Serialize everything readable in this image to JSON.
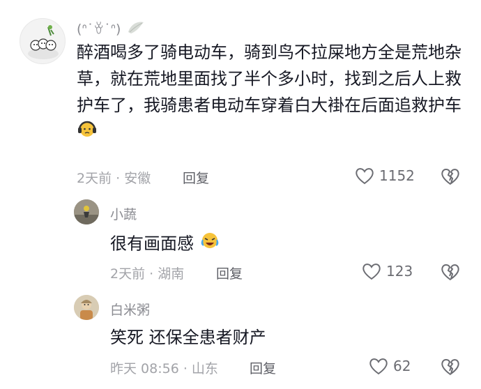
{
  "comments": [
    {
      "username": "(ᐢ˙ꈊ˙ᐢ)",
      "text": "醉酒喝多了骑电动车，骑到鸟不拉屎地方全是荒地杂草，就在荒地里面找了半个多小时，找到之后人上救护车了，我骑患者电动车穿着白大褂在后面追救护车",
      "emoji_icon": "headphone-face-emoji-icon",
      "meta": "2天前 · 安徽",
      "reply_label": "回复",
      "like_count": "1152"
    },
    {
      "username": "小蔬",
      "text": "很有画面感",
      "emoji_icon": "laughing-crying-emoji-icon",
      "meta": "2天前 · 湖南",
      "reply_label": "回复",
      "like_count": "123"
    },
    {
      "username": "白米粥",
      "text": "笑死 还保全患者财产",
      "meta": "昨天 08:56 · 山东",
      "reply_label": "回复",
      "like_count": "62"
    }
  ],
  "colors": {
    "text_primary": "#161823",
    "text_secondary": "#8a8b91",
    "icon": "#6b6c72"
  }
}
